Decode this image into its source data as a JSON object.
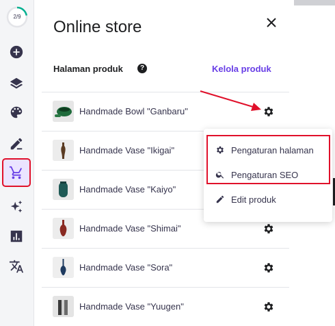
{
  "onboarding": {
    "progress_text": "2/9",
    "progress_fraction": 0.222
  },
  "sidebar": {
    "items": [
      {
        "name": "add",
        "icon": "plus-circle-icon"
      },
      {
        "name": "layers",
        "icon": "layers-icon"
      },
      {
        "name": "styles",
        "icon": "palette-icon"
      },
      {
        "name": "edit",
        "icon": "pencil-icon"
      },
      {
        "name": "store",
        "icon": "cart-icon",
        "active": true
      },
      {
        "name": "ai-tools",
        "icon": "sparkles-icon"
      },
      {
        "name": "analytics",
        "icon": "bar-chart-icon"
      },
      {
        "name": "translate",
        "icon": "translate-icon"
      }
    ]
  },
  "panel": {
    "title": "Online store",
    "section_label": "Halaman produk",
    "help_glyph": "?",
    "manage_link": "Kelola produk",
    "products": [
      {
        "name": "Handmade Bowl \"Ganbaru\""
      },
      {
        "name": "Handmade Vase \"Ikigai\""
      },
      {
        "name": "Handmade Vase \"Kaiyo\""
      },
      {
        "name": "Handmade Vase \"Shimai\""
      },
      {
        "name": "Handmade Vase \"Sora\""
      },
      {
        "name": "Handmade Vase \"Yuugen\""
      }
    ]
  },
  "menu": {
    "items": [
      {
        "label": "Pengaturan halaman",
        "icon": "gear-icon"
      },
      {
        "label": "Pengaturan SEO",
        "icon": "search-icon"
      },
      {
        "label": "Edit produk",
        "icon": "pencil-icon"
      }
    ]
  },
  "colors": {
    "accent": "#673de6",
    "annotation": "#e0102a",
    "active_bg": "#ebe4ff"
  }
}
